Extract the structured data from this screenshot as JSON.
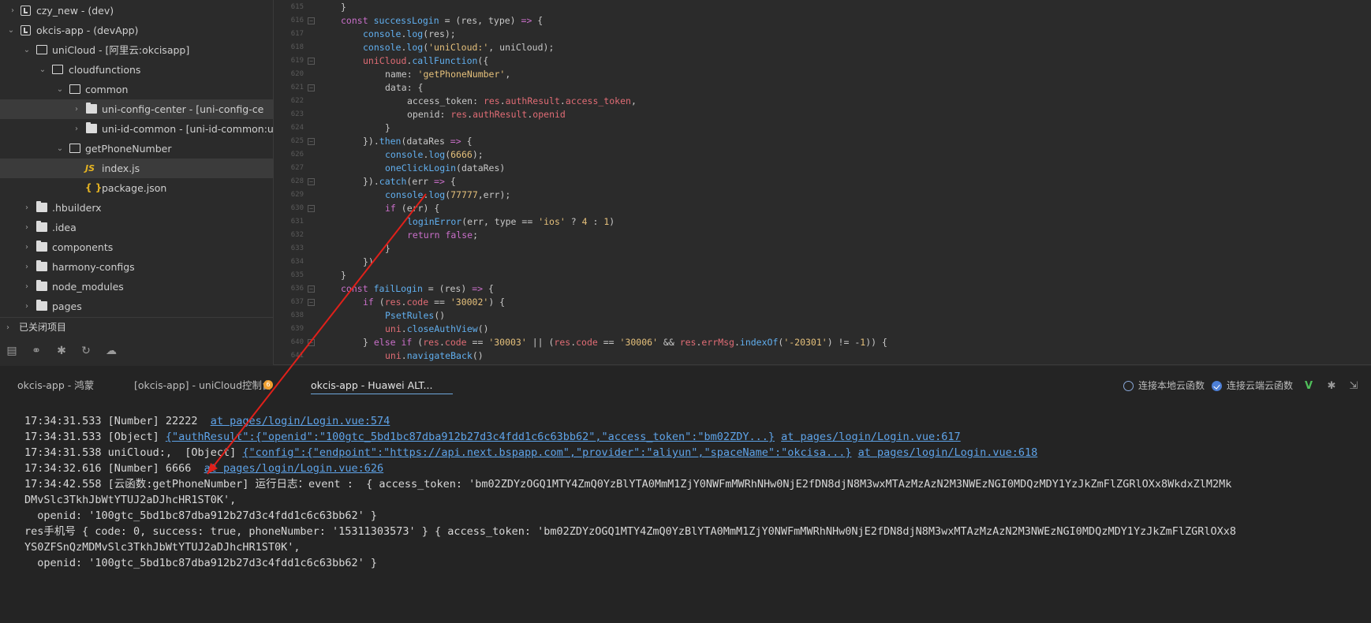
{
  "sidebar": {
    "items": [
      {
        "label": "czy_new - (dev)",
        "icon": "project-icon"
      },
      {
        "label": "okcis-app - (devApp)",
        "icon": "project-icon"
      },
      {
        "label": "uniCloud - [阿里云:okcisapp]",
        "icon": "folder-open-icon"
      },
      {
        "label": "cloudfunctions",
        "icon": "folder-open-icon"
      },
      {
        "label": "common",
        "icon": "folder-open-icon"
      },
      {
        "label": "uni-config-center - [uni-config-ce",
        "icon": "folder-icon"
      },
      {
        "label": "uni-id-common - [uni-id-common:uni",
        "icon": "folder-icon"
      },
      {
        "label": "getPhoneNumber",
        "icon": "folder-open-icon"
      },
      {
        "label": "index.js",
        "icon": "js-file-icon"
      },
      {
        "label": "package.json",
        "icon": "json-file-icon"
      },
      {
        "label": ".hbuilderx",
        "icon": "folder-icon"
      },
      {
        "label": ".idea",
        "icon": "folder-icon"
      },
      {
        "label": "components",
        "icon": "folder-icon"
      },
      {
        "label": "harmony-configs",
        "icon": "folder-icon"
      },
      {
        "label": "node_modules",
        "icon": "folder-icon"
      },
      {
        "label": "pages",
        "icon": "folder-icon"
      }
    ],
    "closed_projects": "已关闭项目",
    "icon_js": "JS",
    "icon_json": "{ }"
  },
  "editor": {
    "line_numbers": [
      "615",
      "616",
      "617",
      "618",
      "619",
      "620",
      "621",
      "622",
      "623",
      "624",
      "625",
      "626",
      "627",
      "628",
      "629",
      "630",
      "631",
      "632",
      "633",
      "634",
      "635",
      "636",
      "637",
      "638",
      "639",
      "640",
      "641"
    ]
  },
  "panel": {
    "tabs": [
      {
        "label": "okcis-app - 鸿蒙"
      },
      {
        "label": "[okcis-app] - uniCloud控制台"
      },
      {
        "label": "okcis-app - Huawei ALT..."
      }
    ],
    "badge": "6",
    "options": [
      {
        "label": "连接本地云函数",
        "checked": false
      },
      {
        "label": "连接云端云函数",
        "checked": true
      }
    ]
  },
  "console": {
    "line1": {
      "time": "17:34:31.533",
      "text": " [Number] 22222  ",
      "link": "at pages/login/Login.vue:574"
    },
    "line2": {
      "time": "17:34:31.533",
      "text": " [Object] ",
      "obj": "{\"authResult\":{\"openid\":\"100gtc_5bd1bc87dba912b27d3c4fdd1c6c63bb62\",\"access_token\":\"bm02ZDY...}",
      "link": "at pages/login/Login.vue:617"
    },
    "line3": {
      "time": "17:34:31.538",
      "text": " uniCloud:,  [Object] ",
      "obj": "{\"config\":{\"endpoint\":\"https://api.next.bspapp.com\",\"provider\":\"aliyun\",\"spaceName\":\"okcisa...}",
      "link": "at pages/login/Login.vue:618"
    },
    "line4": {
      "time": "17:34:32.616",
      "text": " [Number] 6666  ",
      "link": "at pages/login/Login.vue:626"
    },
    "line5": {
      "time": "17:34:42.558",
      "text": " [云函数:getPhoneNumber] 运行日志：event :  { access_token: 'bm02ZDYzOGQ1MTY4ZmQ0YzBlYTA0MmM1ZjY0NWFmMWRhNHw0NjE2fDN8djN8M3wxMTAzMzAzN2M3NWEzNGI0MDQzMDY1YzJkZmFlZGRlOXx8WkdxZlM2Mk"
    },
    "line6": "DMvSlc3TkhJbWtYTUJ2aDJhcHR1ST0K',",
    "line7": "  openid: '100gtc_5bd1bc87dba912b27d3c4fdd1c6c63bb62' }",
    "line8": "res手机号 { code: 0, success: true, phoneNumber: '15311303573' } { access_token: 'bm02ZDYzOGQ1MTY4ZmQ0YzBlYTA0MmM1ZjY0NWFmMWRhNHw0NjE2fDN8djN8M3wxMTAzMzAzN2M3NWEzNGI0MDQzMDY1YzJkZmFlZGRlOXx8",
    "line9": "YS0ZFSnQzMDMvSlc3TkhJbWtYTUJ2aDJhcHR1ST0K',",
    "line10": "  openid: '100gtc_5bd1bc87dba912b27d3c4fdd1c6c63bb62' }"
  },
  "colors": {
    "accent": "#4d7fd6",
    "link": "#5ea3e8",
    "arrow": "#e0201a",
    "badge": "#f0a030"
  }
}
